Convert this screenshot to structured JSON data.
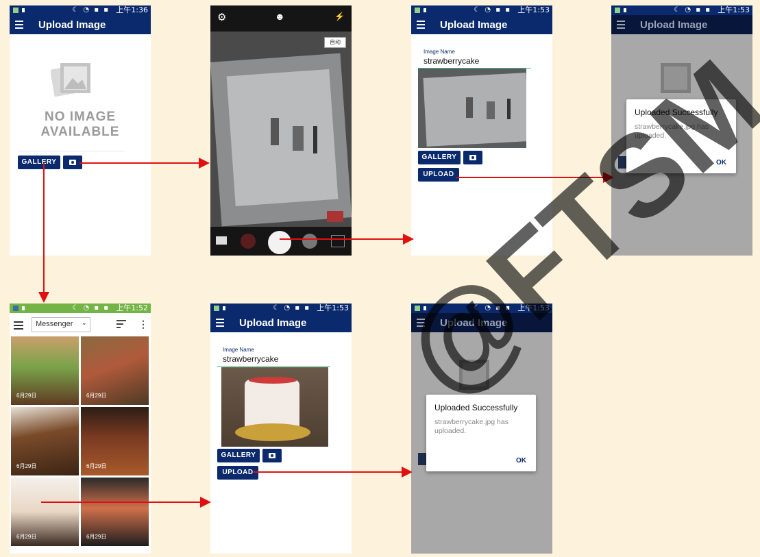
{
  "colors": {
    "app_bar": "#0b2a6e",
    "status_bar": "#0b2a6e",
    "gallery_status_bar": "#74b447",
    "arrow": "#e01010",
    "background": "#fdf3dc",
    "button": "#0b2a6e"
  },
  "screen1": {
    "time": "上午1:36",
    "title": "Upload Image",
    "placeholder_line1": "NO IMAGE",
    "placeholder_line2": "AVAILABLE",
    "gallery_btn": "GALLERY"
  },
  "screen2": {
    "auto_label": "自动"
  },
  "screen3": {
    "time": "上午1:53",
    "title": "Upload Image",
    "image_name_label": "Image Name",
    "image_name_value": "strawberrycake",
    "gallery_btn": "GALLERY",
    "upload_btn": "UPLOAD"
  },
  "screen4": {
    "time": "上午1:53",
    "title": "Upload Image",
    "dialog_title": "Uploaded Successfully",
    "dialog_message": "strawberrycake.jpg has uploaded.",
    "dialog_ok": "OK"
  },
  "screen5": {
    "time": "上午1:52",
    "album": "Messenger",
    "dates": [
      "6月29日",
      "6月29日",
      "6月29日",
      "6月29日",
      "6月29日",
      "6月29日"
    ]
  },
  "screen6": {
    "time": "上午1:53",
    "title": "Upload Image",
    "image_name_label": "Image Name",
    "image_name_value": "strawberrycake",
    "gallery_btn": "GALLERY",
    "upload_btn": "UPLOAD"
  },
  "screen7": {
    "time": "上午1:53",
    "title": "Upload Image",
    "dialog_title": "Uploaded Successfully",
    "dialog_message": "strawberrycake.jpg has uploaded.",
    "dialog_ok": "OK"
  },
  "watermark": "@FTSM"
}
